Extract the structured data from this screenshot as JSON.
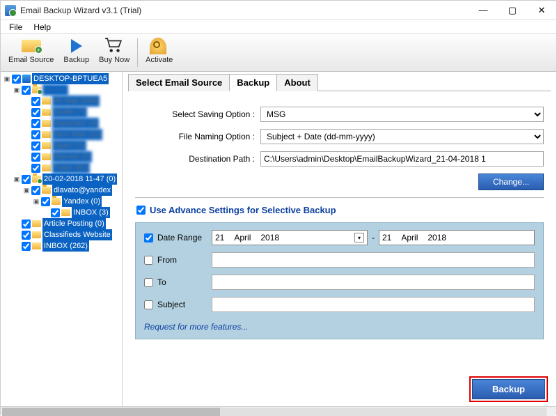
{
  "window": {
    "title": "Email Backup Wizard v3.1 (Trial)"
  },
  "menu": {
    "file": "File",
    "help": "Help"
  },
  "toolbar": {
    "email_source": "Email Source",
    "backup": "Backup",
    "buy_now": "Buy Now",
    "activate": "Activate"
  },
  "tree": {
    "root": "DESKTOP-BPTUEA5",
    "blurred": "———",
    "all_mail": "All Mail (558)",
    "drafts": "Drafts (7)",
    "important": "Important (3)",
    "sent_mail": "Sent Mail (32)",
    "spam": "Spam (1)",
    "starred": "Starred (0)",
    "trash": "Trash (91)",
    "dated": "20-02-2018 11-47 (0)",
    "dlavato": "dlavato@yandex",
    "yandex": "Yandex (0)",
    "inbox_small": "INBOX (3)",
    "article": "Article Posting (0)",
    "classifieds": "Classifieds Website",
    "inbox_big": "INBOX (262)"
  },
  "tabs": {
    "select_source": "Select Email Source",
    "backup": "Backup",
    "about": "About"
  },
  "form": {
    "saving_label": "Select Saving Option  :",
    "saving_value": "MSG",
    "naming_label": "File Naming Option  :",
    "naming_value": "Subject + Date (dd-mm-yyyy)",
    "dest_label": "Destination Path  :",
    "dest_value": "C:\\Users\\admin\\Desktop\\EmailBackupWizard_21-04-2018 1",
    "change": "Change..."
  },
  "advanced": {
    "title": "Use Advance Settings for Selective Backup",
    "date_range": "Date Range",
    "from": "From",
    "to": "To",
    "subject": "Subject",
    "d1_day": "21",
    "d1_month": "April",
    "d1_year": "2018",
    "d2_day": "21",
    "d2_month": "April",
    "d2_year": "2018",
    "request": "Request for more features..."
  },
  "actions": {
    "backup": "Backup"
  }
}
